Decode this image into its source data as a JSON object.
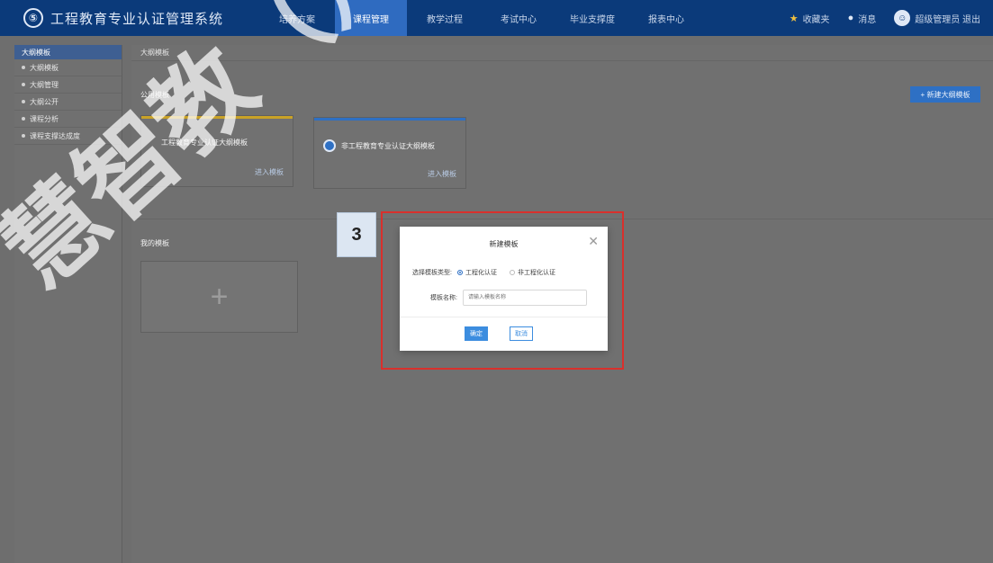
{
  "header": {
    "logo": "⑤",
    "title": "工程教育专业认证管理系统",
    "nav": [
      "培养方案",
      "课程管理",
      "教学过程",
      "考试中心",
      "毕业支撑度",
      "报表中心"
    ],
    "active_nav": 1,
    "tools": {
      "favorite": "收藏夹",
      "messages": "消息",
      "user": "超级管理员 退出"
    }
  },
  "sidebar": {
    "head": "大纲模板",
    "items": [
      "大纲模板",
      "大纲管理",
      "大纲公开",
      "课程分析",
      "课程支撑达成度"
    ]
  },
  "main": {
    "breadcrumb": "大纲模板",
    "section_common": "公用模板",
    "create_button": "+ 新建大纲模板",
    "templates": [
      {
        "name": "工程教育专业认证大纲模板",
        "link": "进入模板",
        "accent": "#c9a227"
      },
      {
        "name": "非工程教育专业认证大纲模板",
        "link": "进入模板",
        "accent": "#2e70c4"
      }
    ],
    "section_mine": "我的模板",
    "add_symbol": "+"
  },
  "dialog": {
    "title": "新建模板",
    "close": "✕",
    "type_label": "选择模板类型:",
    "type_options": [
      "工程化认证",
      "非工程化认证"
    ],
    "selected_type": 0,
    "name_label": "模板名称:",
    "name_placeholder": "请输入模板名称",
    "ok": "确定",
    "cancel": "取消"
  },
  "callout": {
    "step": "3",
    "highlight_color": "#d9302c"
  },
  "watermark": "慧智教（）"
}
